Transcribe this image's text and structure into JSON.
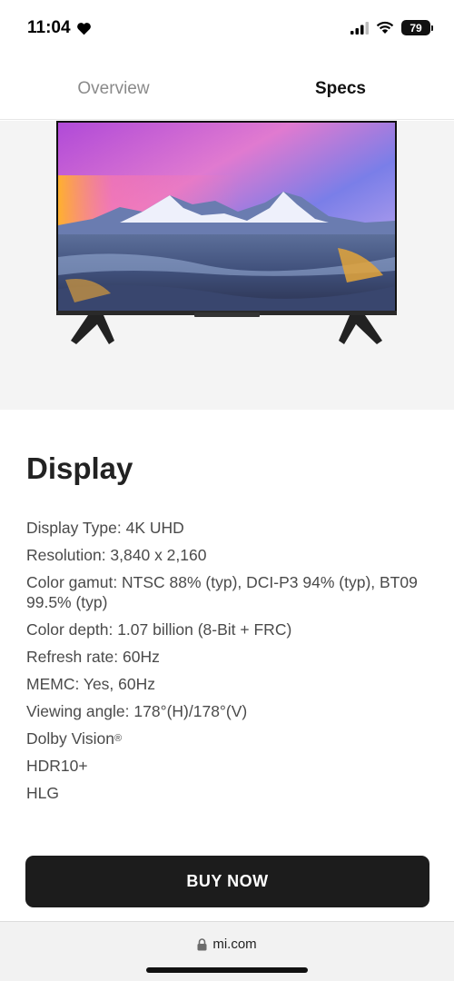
{
  "status_bar": {
    "time": "11:04",
    "battery": "79",
    "icons": [
      "heart-icon",
      "signal-icon",
      "wifi-icon",
      "battery-icon"
    ]
  },
  "tabs": [
    {
      "label": "Overview",
      "active": false
    },
    {
      "label": "Specs",
      "active": true
    }
  ],
  "hero": {
    "image": "tv-with-mountain-landscape"
  },
  "section": {
    "title": "Display",
    "specs": [
      "Display Type: 4K UHD",
      "Resolution: 3,840 x 2,160",
      "Color gamut: NTSC 88% (typ), DCI-P3 94% (typ), BT09 99.5% (typ)",
      "Color depth: 1.07 billion (8-Bit + FRC)",
      "Refresh rate: 60Hz",
      "MEMC: Yes, 60Hz",
      "Viewing angle: 178°(H)/178°(V)",
      "Dolby Vision",
      "HDR10+",
      "HLG"
    ],
    "dolby_mark": "®"
  },
  "buy": {
    "label": "BUY NOW"
  },
  "browser": {
    "url": "mi.com",
    "icons": [
      "lock-icon"
    ]
  }
}
